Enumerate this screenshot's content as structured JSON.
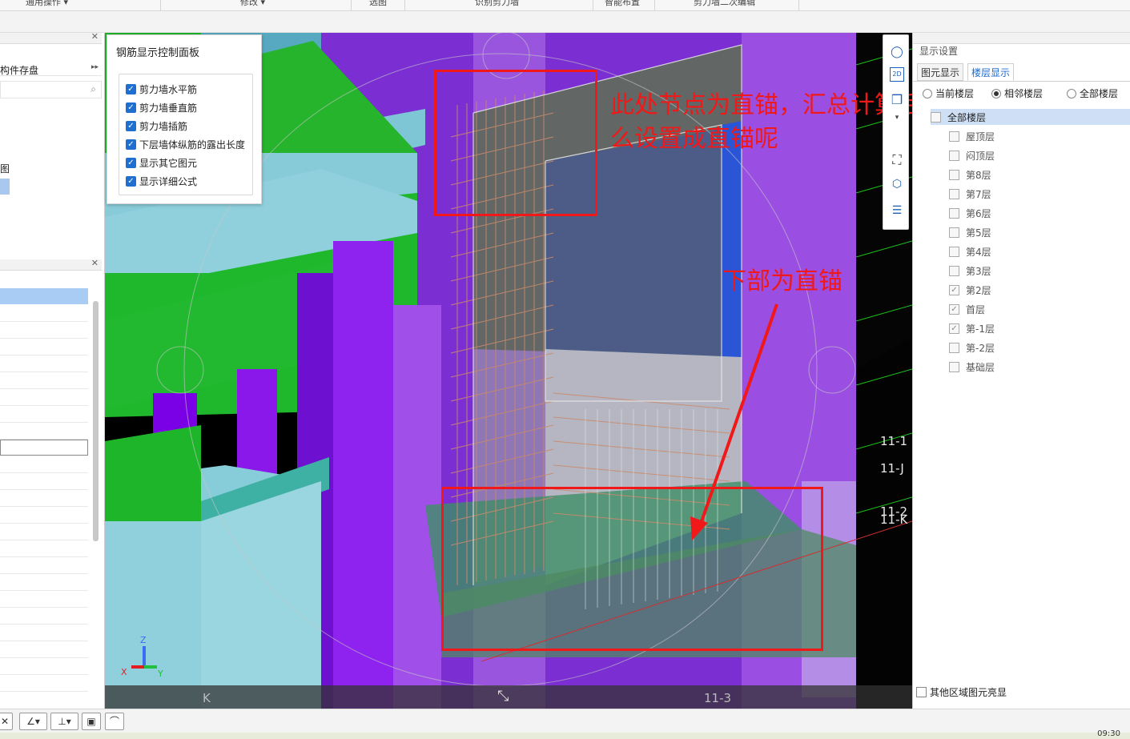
{
  "ribbon": {
    "groups": [
      {
        "label": "通用操作 ▾"
      },
      {
        "label": "修改 ▾"
      },
      {
        "label": "选图"
      },
      {
        "label": "识别剪力墙"
      },
      {
        "label": "智能布置"
      },
      {
        "label": "剪力墙二次编辑"
      }
    ]
  },
  "left_panel": {
    "partial_label_1": "构件存盘",
    "more_glyph": "▸▸",
    "partial_label_2": "图",
    "close_glyph": "✕"
  },
  "rebar_panel": {
    "title": "钢筋显示控制面板",
    "options": [
      {
        "label": "剪力墙水平筋",
        "checked": true
      },
      {
        "label": "剪力墙垂直筋",
        "checked": true
      },
      {
        "label": "剪力墙插筋",
        "checked": true
      },
      {
        "label": "下层墙体纵筋的露出长度",
        "checked": true
      },
      {
        "label": "显示其它图元",
        "checked": true
      },
      {
        "label": "显示详细公式",
        "checked": true
      }
    ],
    "check_glyph": "✓"
  },
  "view_tools": {
    "icons": [
      "orbit-icon",
      "2d-view-icon",
      "3d-box-icon",
      "fullscreen-icon",
      "cube-view-icon",
      "display-settings-icon"
    ],
    "label_2d": "2D"
  },
  "viewport": {
    "axis_labels": [
      "11-1",
      "11-J",
      "11-2",
      "11-K",
      "11-3",
      "K"
    ],
    "axis_x": "X",
    "axis_y": "Y",
    "axis_z": "Z",
    "exit_fullscreen_glyph": "⤡"
  },
  "annotations": {
    "top_line1": "此处节点为直锚，汇总计算后有弯折，怎",
    "top_line2": "么设置成直锚呢",
    "bottom": "下部为直锚",
    "colors": {
      "red": "#f01818"
    }
  },
  "right_panel": {
    "title": "显示设置",
    "tabs": [
      {
        "label": "图元显示",
        "active": false
      },
      {
        "label": "楼层显示",
        "active": true
      }
    ],
    "scope_options": [
      {
        "label": "当前楼层",
        "selected": false
      },
      {
        "label": "相邻楼层",
        "selected": true
      },
      {
        "label": "全部楼层",
        "selected": false
      }
    ],
    "floor_all": "全部楼层",
    "floors": [
      {
        "label": "屋顶层",
        "checked": false
      },
      {
        "label": "闷顶层",
        "checked": false
      },
      {
        "label": "第8层",
        "checked": false
      },
      {
        "label": "第7层",
        "checked": false
      },
      {
        "label": "第6层",
        "checked": false
      },
      {
        "label": "第5层",
        "checked": false
      },
      {
        "label": "第4层",
        "checked": false
      },
      {
        "label": "第3层",
        "checked": false
      },
      {
        "label": "第2层",
        "checked": true
      },
      {
        "label": "首层",
        "checked": true
      },
      {
        "label": "第-1层",
        "checked": true
      },
      {
        "label": "第-2层",
        "checked": false
      },
      {
        "label": "基础层",
        "checked": false
      }
    ],
    "other_region": "其他区域图元亮显"
  },
  "bottom_bar": {
    "buttons": [
      "close-tool-icon",
      "angle-tool-icon",
      "offset-tool-icon",
      "snap-tool-icon",
      "arc-tool-icon"
    ]
  },
  "status_bar": {
    "text": "09:30"
  }
}
